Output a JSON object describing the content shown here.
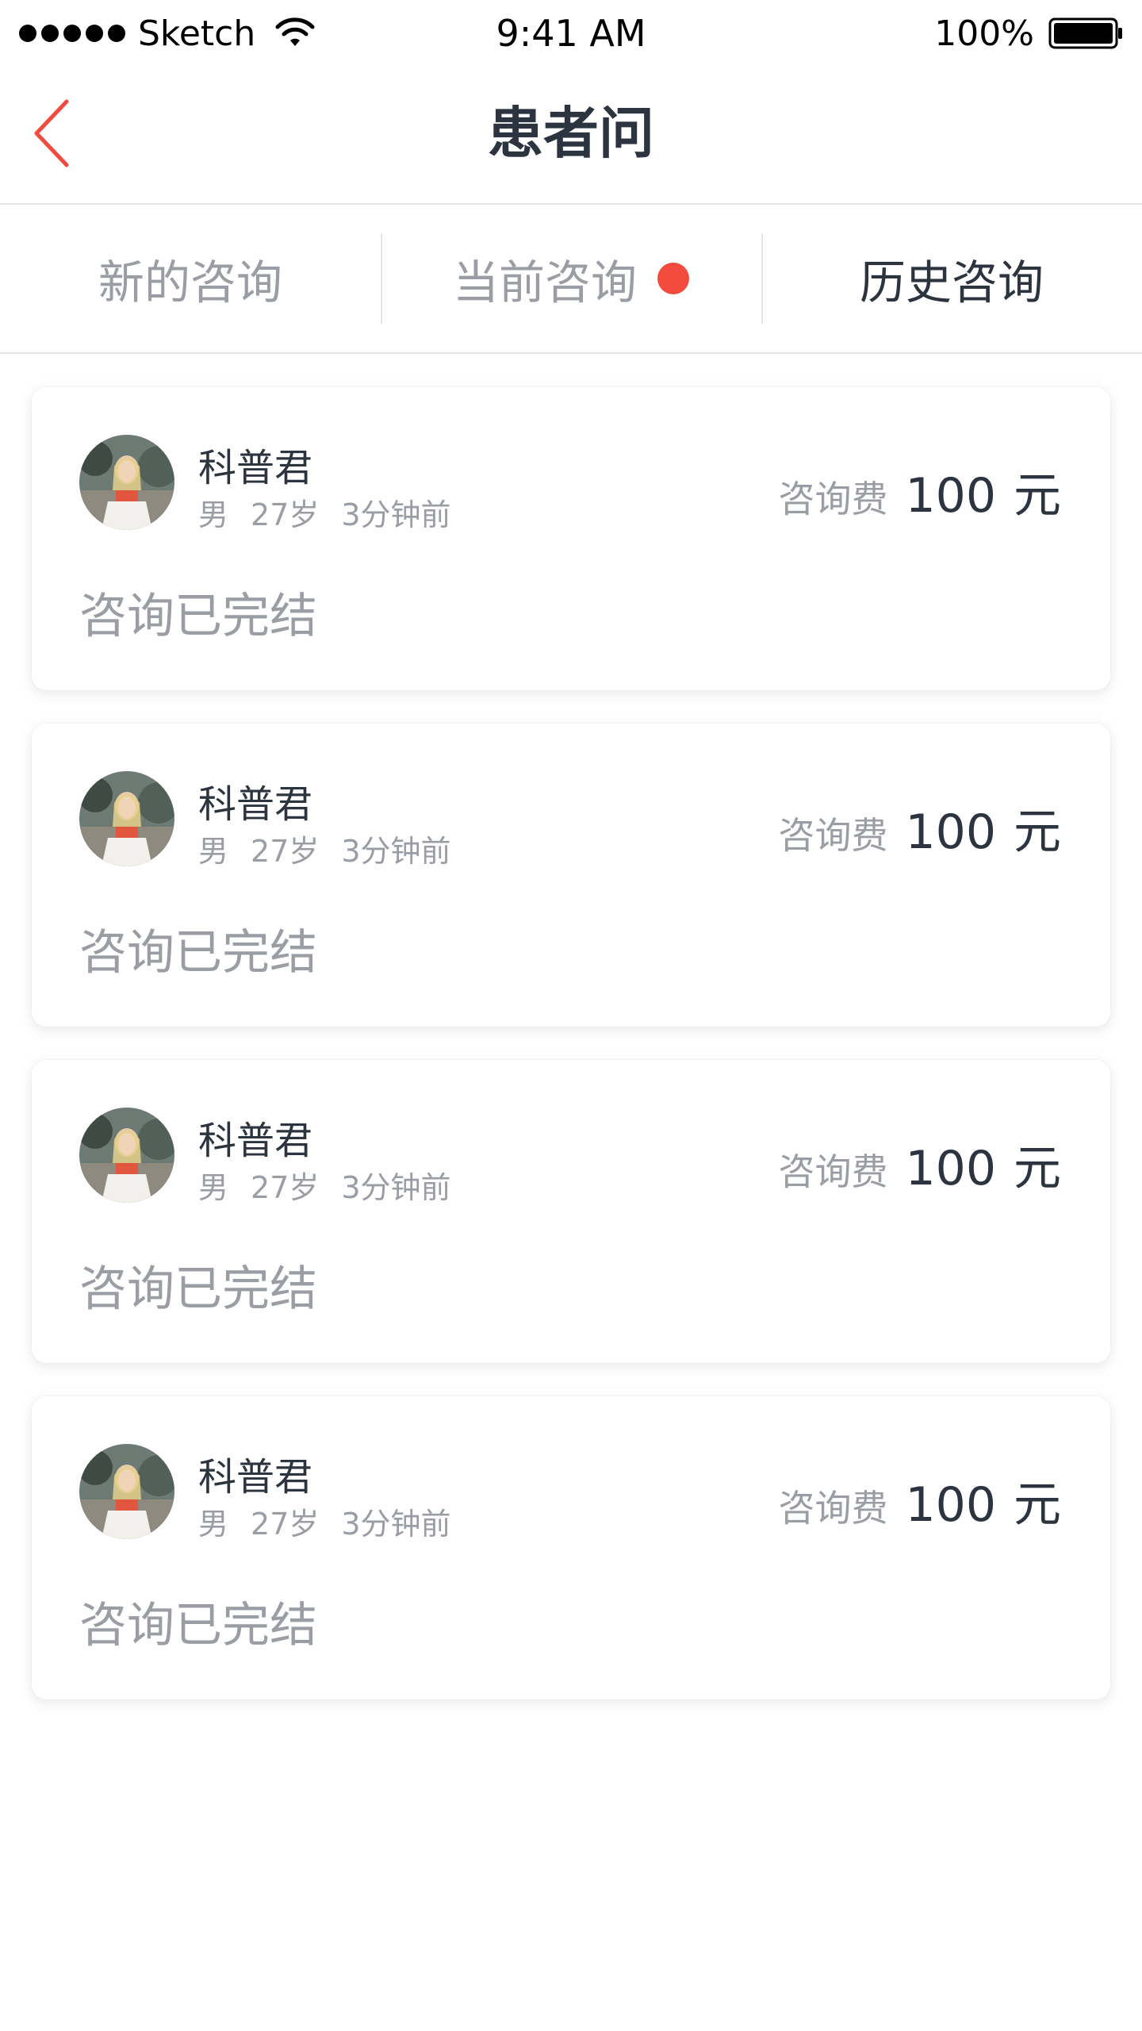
{
  "status_bar": {
    "carrier": "Sketch",
    "time": "9:41 AM",
    "battery": "100%"
  },
  "navbar": {
    "title": "患者问",
    "back_icon": "chevron-left-icon"
  },
  "tabs": [
    {
      "label": "新的咨询",
      "active": false,
      "has_dot": false
    },
    {
      "label": "当前咨询",
      "active": false,
      "has_dot": true
    },
    {
      "label": "历史咨询",
      "active": true,
      "has_dot": false
    }
  ],
  "colors": {
    "accent": "#f24a3c",
    "text_primary": "#2c3440",
    "text_secondary": "#9a9ea4",
    "divider": "#e4e6ea"
  },
  "consultations": [
    {
      "name": "科普君",
      "gender": "男",
      "age": "27岁",
      "time": "3分钟前",
      "fee_label": "咨询费",
      "fee_amount": "100",
      "fee_unit": "元",
      "status": "咨询已完结"
    },
    {
      "name": "科普君",
      "gender": "男",
      "age": "27岁",
      "time": "3分钟前",
      "fee_label": "咨询费",
      "fee_amount": "100",
      "fee_unit": "元",
      "status": "咨询已完结"
    },
    {
      "name": "科普君",
      "gender": "男",
      "age": "27岁",
      "time": "3分钟前",
      "fee_label": "咨询费",
      "fee_amount": "100",
      "fee_unit": "元",
      "status": "咨询已完结"
    },
    {
      "name": "科普君",
      "gender": "男",
      "age": "27岁",
      "time": "3分钟前",
      "fee_label": "咨询费",
      "fee_amount": "100",
      "fee_unit": "元",
      "status": "咨询已完结"
    }
  ]
}
